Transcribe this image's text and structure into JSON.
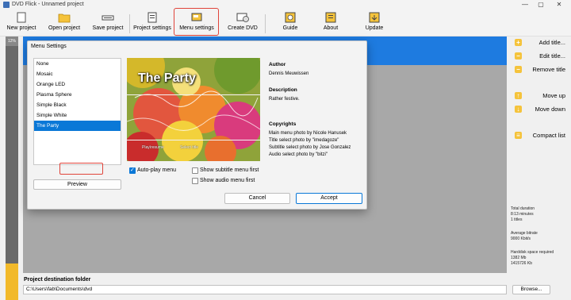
{
  "window": {
    "title": "DVD Flick - Unnamed project",
    "minimize": "—",
    "maximize": "▢",
    "close": "✕"
  },
  "toolbar": {
    "new_project": "New project",
    "open_project": "Open project",
    "save_project": "Save project",
    "project_settings": "Project settings",
    "menu_settings": "Menu settings",
    "create_dvd": "Create DVD",
    "guide": "Guide",
    "about": "About",
    "update": "Update"
  },
  "left_strip": {
    "percent": "12%"
  },
  "right_panel": {
    "add_title": "Add title...",
    "edit_title": "Edit title...",
    "remove_title": "Remove title",
    "move_up": "Move up",
    "move_down": "Move down",
    "compact_list": "Compact list"
  },
  "stats": {
    "total_duration_label": "Total duration",
    "total_duration_value": "8:13 minutes",
    "titles": "1 titles",
    "avg_bitrate_label": "Average bitrate",
    "avg_bitrate_value": "9000 Kbit/s",
    "harddisk_label": "Harddisk space required",
    "harddisk_mb": "1382 Mb",
    "harddisk_kb": "1415726 Kb"
  },
  "destination": {
    "label": "Project destination folder",
    "path": "C:\\Users\\fab\\Documents\\dvd",
    "browse": "Browse..."
  },
  "dialog": {
    "title": "Menu Settings",
    "menus": [
      "None",
      "Mosaic",
      "Orange LED",
      "Plasma Sphere",
      "Simple Black",
      "Simple White",
      "The Party"
    ],
    "selected_menu": "The Party",
    "preview_button": "Preview",
    "preview": {
      "title": "The Party",
      "play_resume": "Play\\resume",
      "select_title": "Select title"
    },
    "autoplay_label": "Auto-play menu",
    "autoplay_checked": true,
    "subtitle_first_label": "Show subtitle menu first",
    "audio_first_label": "Show audio menu first",
    "author_heading": "Author",
    "author": "Dennis Meuwissen",
    "description_heading": "Description",
    "description": "Rather festive.",
    "copyrights_heading": "Copyrights",
    "copyrights": [
      "Main menu photo by Nicole Hanusek",
      "Title select photo by \"imedagoze\"",
      "Subtitle select photo by Jose Gonzalez",
      "Audio select photo by \"bitzi\""
    ],
    "cancel": "Cancel",
    "accept": "Accept"
  },
  "colors": {
    "accent_blue": "#0a78d7",
    "highlight_red": "#e0443a",
    "icon_yellow": "#f5c33b"
  }
}
